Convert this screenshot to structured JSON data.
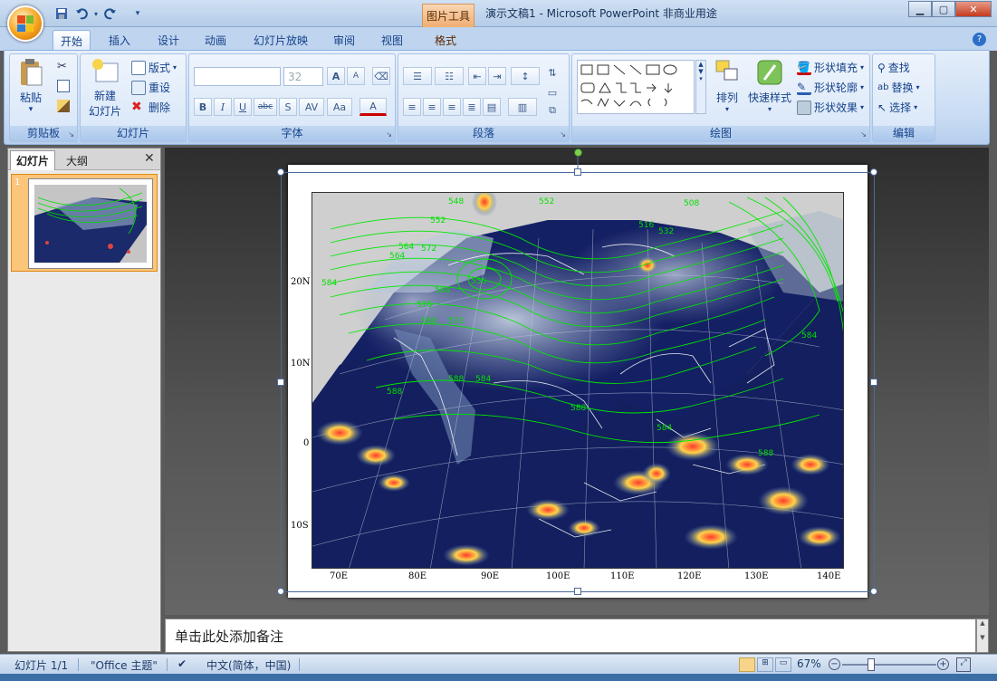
{
  "titlebar": {
    "context_tab": "图片工具",
    "title": "演示文稿1 - Microsoft PowerPoint 非商业用途",
    "minimize_icon": "minimize-icon",
    "maximize_icon": "maximize-icon",
    "close_icon": "close-icon"
  },
  "tabs": [
    {
      "label": "开始",
      "active": true
    },
    {
      "label": "插入"
    },
    {
      "label": "设计"
    },
    {
      "label": "动画"
    },
    {
      "label": "幻灯片放映"
    },
    {
      "label": "审阅"
    },
    {
      "label": "视图"
    },
    {
      "label": "格式"
    }
  ],
  "ribbon": {
    "clipboard": {
      "label": "剪贴板",
      "paste": "粘贴",
      "paste_arrow": "▾"
    },
    "slides": {
      "label": "幻灯片",
      "new_slide_1": "新建",
      "new_slide_2": "幻灯片",
      "layout": "版式",
      "reset": "重设",
      "delete": "删除"
    },
    "font": {
      "label": "字体",
      "font_name": "",
      "font_size": "32",
      "bold": "B",
      "italic": "I",
      "underline": "U",
      "strike": "abc",
      "shadow": "S",
      "spacing": "AV",
      "case": "Aa",
      "color": "A",
      "grow": "A",
      "shrink": "A"
    },
    "paragraph": {
      "label": "段落"
    },
    "drawing": {
      "label": "绘图",
      "arrange": "排列",
      "quick_styles": "快速样式",
      "shape_fill": "形状填充",
      "shape_outline": "形状轮廓",
      "shape_effects": "形状效果"
    },
    "editing": {
      "label": "编辑",
      "find": "查找",
      "replace": "替换",
      "select": "选择"
    }
  },
  "left_pane": {
    "tab_slides": "幻灯片",
    "tab_outline": "大纲",
    "slide_number": "1",
    "close_icon": "close-icon"
  },
  "map": {
    "lat_labels": [
      "20N",
      "10N",
      "0",
      "10S"
    ],
    "lon_labels": [
      "70E",
      "80E",
      "90E",
      "100E",
      "110E",
      "120E",
      "130E",
      "140E"
    ],
    "contour_labels": [
      "548",
      "552",
      "556",
      "560",
      "564",
      "568",
      "572",
      "576",
      "580",
      "584",
      "588",
      "516",
      "532",
      "508"
    ]
  },
  "notes": {
    "placeholder": "单击此处添加备注"
  },
  "statusbar": {
    "slide_info": "幻灯片 1/1",
    "theme": "\"Office 主题\"",
    "language": "中文(简体，中国)",
    "zoom": "67%"
  },
  "colors": {
    "ribbon_bg": "#dbe7f7",
    "context_tab": "#f2b27a",
    "contour": "#00e000",
    "ocean": "#12205e"
  }
}
